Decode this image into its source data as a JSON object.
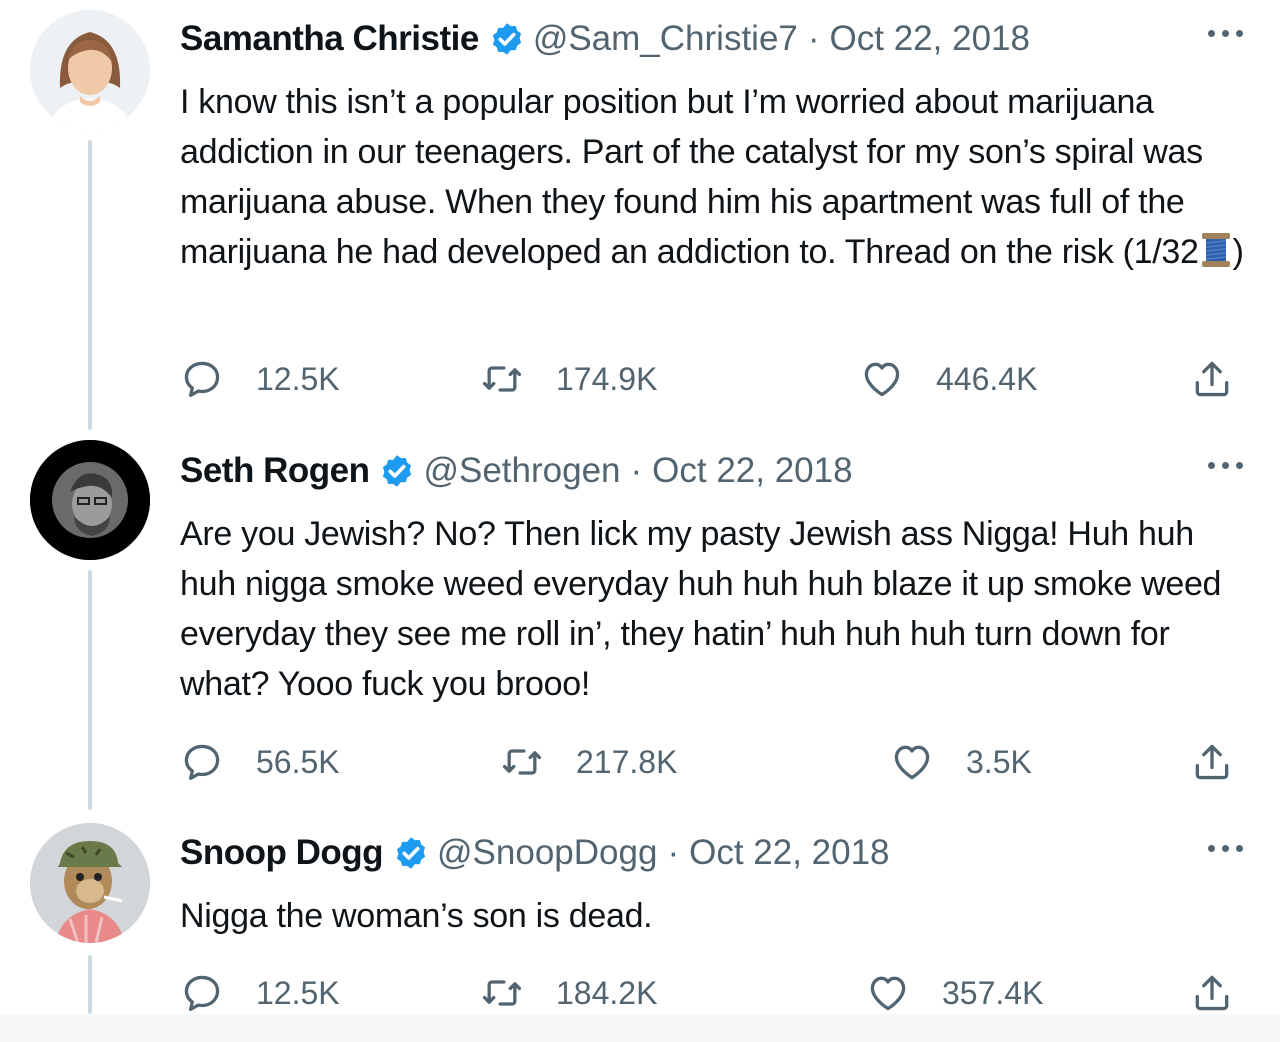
{
  "tweets": [
    {
      "name": "Samantha Christie",
      "handle": "@Sam_Christie7",
      "date": "Oct 22, 2018",
      "text": "I know this isn’t a popular position but I’m worried about marijuana addiction in our teenagers. Part of the catalyst for my son’s spiral was marijuana abuse. When they found him his apartment was full of the marijuana he had developed an addiction to. Thread on the risk (1/32",
      "text_end": ")",
      "replies": "12.5K",
      "retweets": "174.9K",
      "likes": "446.4K"
    },
    {
      "name": "Seth Rogen",
      "handle": "@Sethrogen",
      "date": "Oct 22, 2018",
      "text": "Are you Jewish? No? Then lick my pasty Jewish ass Nigga! Huh huh huh nigga smoke weed everyday huh huh huh blaze it up smoke weed everyday they see me roll in’, they hatin’ huh huh huh turn down for what? Yooo fuck you brooo!",
      "replies": "56.5K",
      "retweets": "217.8K",
      "likes": "3.5K"
    },
    {
      "name": "Snoop Dogg",
      "handle": "@SnoopDogg",
      "date": "Oct 22, 2018",
      "text": "Nigga the woman’s son is dead.",
      "replies": "12.5K",
      "retweets": "184.2K",
      "likes": "357.4K"
    }
  ],
  "separator": "·",
  "colors": {
    "verified": "#1d9bf0",
    "secondary_text": "#536471",
    "thread_line": "#cfd9de"
  },
  "icons": [
    "verified-badge-icon",
    "more-icon",
    "reply-icon",
    "retweet-icon",
    "like-icon",
    "share-icon",
    "thread-spool-emoji"
  ]
}
